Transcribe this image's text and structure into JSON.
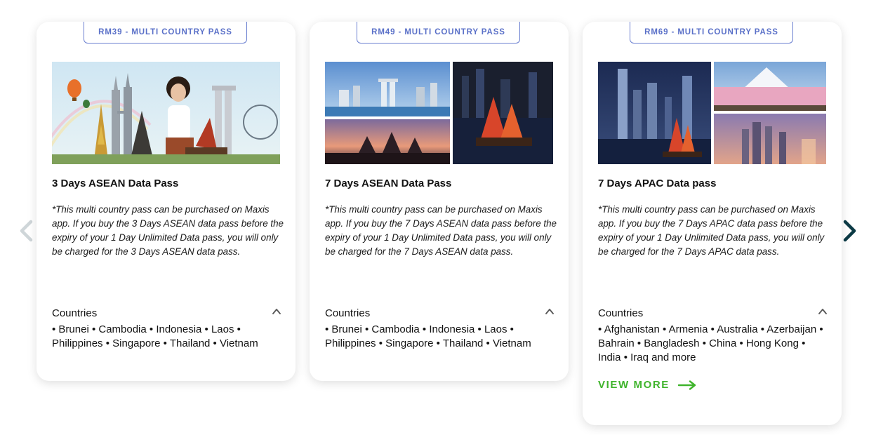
{
  "colors": {
    "badge_accent": "#5a70c8",
    "view_more_green": "#3fb42c",
    "next_arrow": "#0c3a45",
    "prev_arrow_disabled": "#cfd6d9"
  },
  "nav": {
    "prev_icon": "chevron-left-icon",
    "next_icon": "chevron-right-icon"
  },
  "cards": [
    {
      "badge": "RM39 - MULTI COUNTRY PASS",
      "title": "3 Days ASEAN Data Pass",
      "note": "*This multi country pass can be purchased on Maxis app. If you buy the 3 Days ASEAN data pass before the expiry of your 1 Day Unlimited Data pass, you will only be charged for the 3 Days ASEAN data pass.",
      "countries_label": "Countries",
      "countries": "• Brunei • Cambodia • Indonesia • Laos • Philippines • Singapore • Thailand • Vietnam",
      "toggle_icon": "chevron-up-icon"
    },
    {
      "badge": "RM49 - MULTI COUNTRY PASS",
      "title": "7 Days ASEAN Data Pass",
      "note": "*This multi country pass can be purchased on Maxis app. If you buy the 7 Days ASEAN data pass before the expiry of your 1 Day Unlimited Data pass, you will only be charged for the 7 Days ASEAN data pass.",
      "countries_label": "Countries",
      "countries": "• Brunei • Cambodia • Indonesia • Laos • Philippines • Singapore • Thailand • Vietnam",
      "toggle_icon": "chevron-up-icon"
    },
    {
      "badge": "RM69 - MULTI COUNTRY PASS",
      "title": "7 Days APAC Data pass",
      "note": "*This multi country pass can be purchased on Maxis app. If you buy the 7 Days APAC data pass before the expiry of your 1 Day Unlimited Data pass, you will only be charged for the 7 Days APAC data pass.",
      "countries_label": "Countries",
      "countries": "• Afghanistan • Armenia • Australia • Azerbaijan • Bahrain • Bangladesh • China • Hong Kong • India • Iraq and more",
      "toggle_icon": "chevron-up-icon",
      "view_more": "VIEW MORE",
      "view_more_icon": "arrow-right-icon"
    }
  ]
}
